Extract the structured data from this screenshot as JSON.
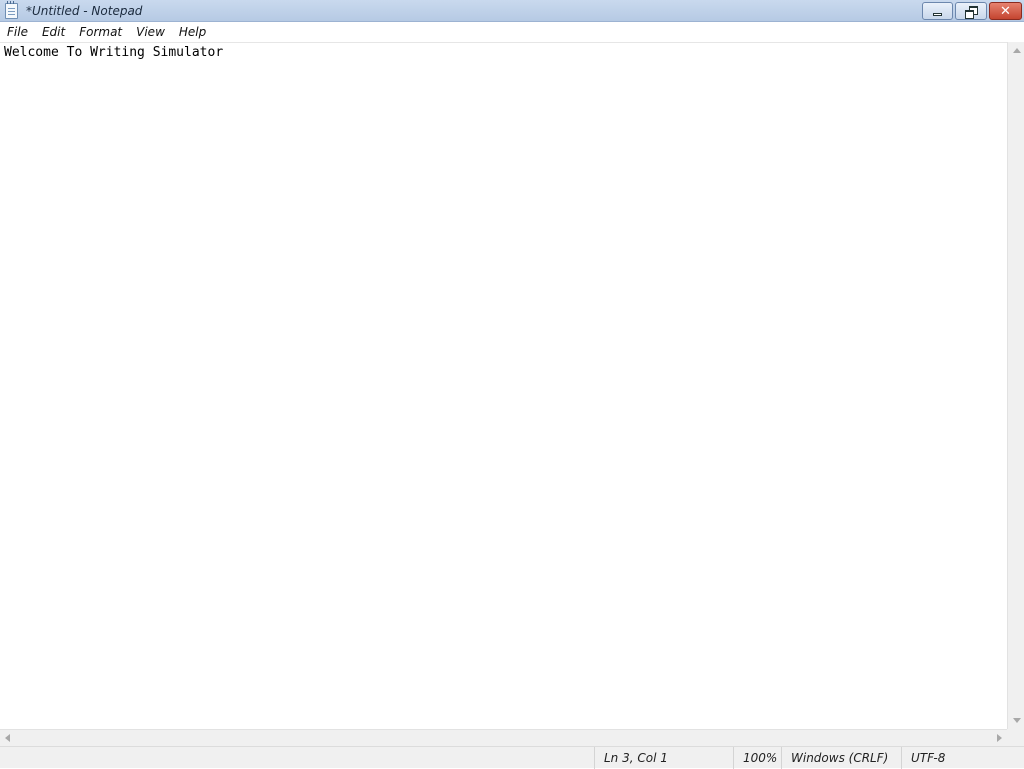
{
  "window": {
    "title": "*Untitled - Notepad",
    "caption_buttons": {
      "minimize": "minimize",
      "restore": "restore",
      "close": "✕"
    }
  },
  "menu": {
    "items": [
      "File",
      "Edit",
      "Format",
      "View",
      "Help"
    ]
  },
  "editor": {
    "content": "Welcome To Writing Simulator"
  },
  "status": {
    "position": "Ln 3, Col 1",
    "zoom": "100%",
    "line_endings": "Windows (CRLF)",
    "encoding": "UTF-8"
  },
  "icons": {
    "app": "notepad-icon",
    "minimize": "minimize-icon",
    "restore": "restore-icon",
    "close": "close-icon"
  },
  "colors": {
    "titlebar": "#c9d9ee",
    "close_button": "#c44530",
    "statusbar": "#f0f0f0"
  }
}
